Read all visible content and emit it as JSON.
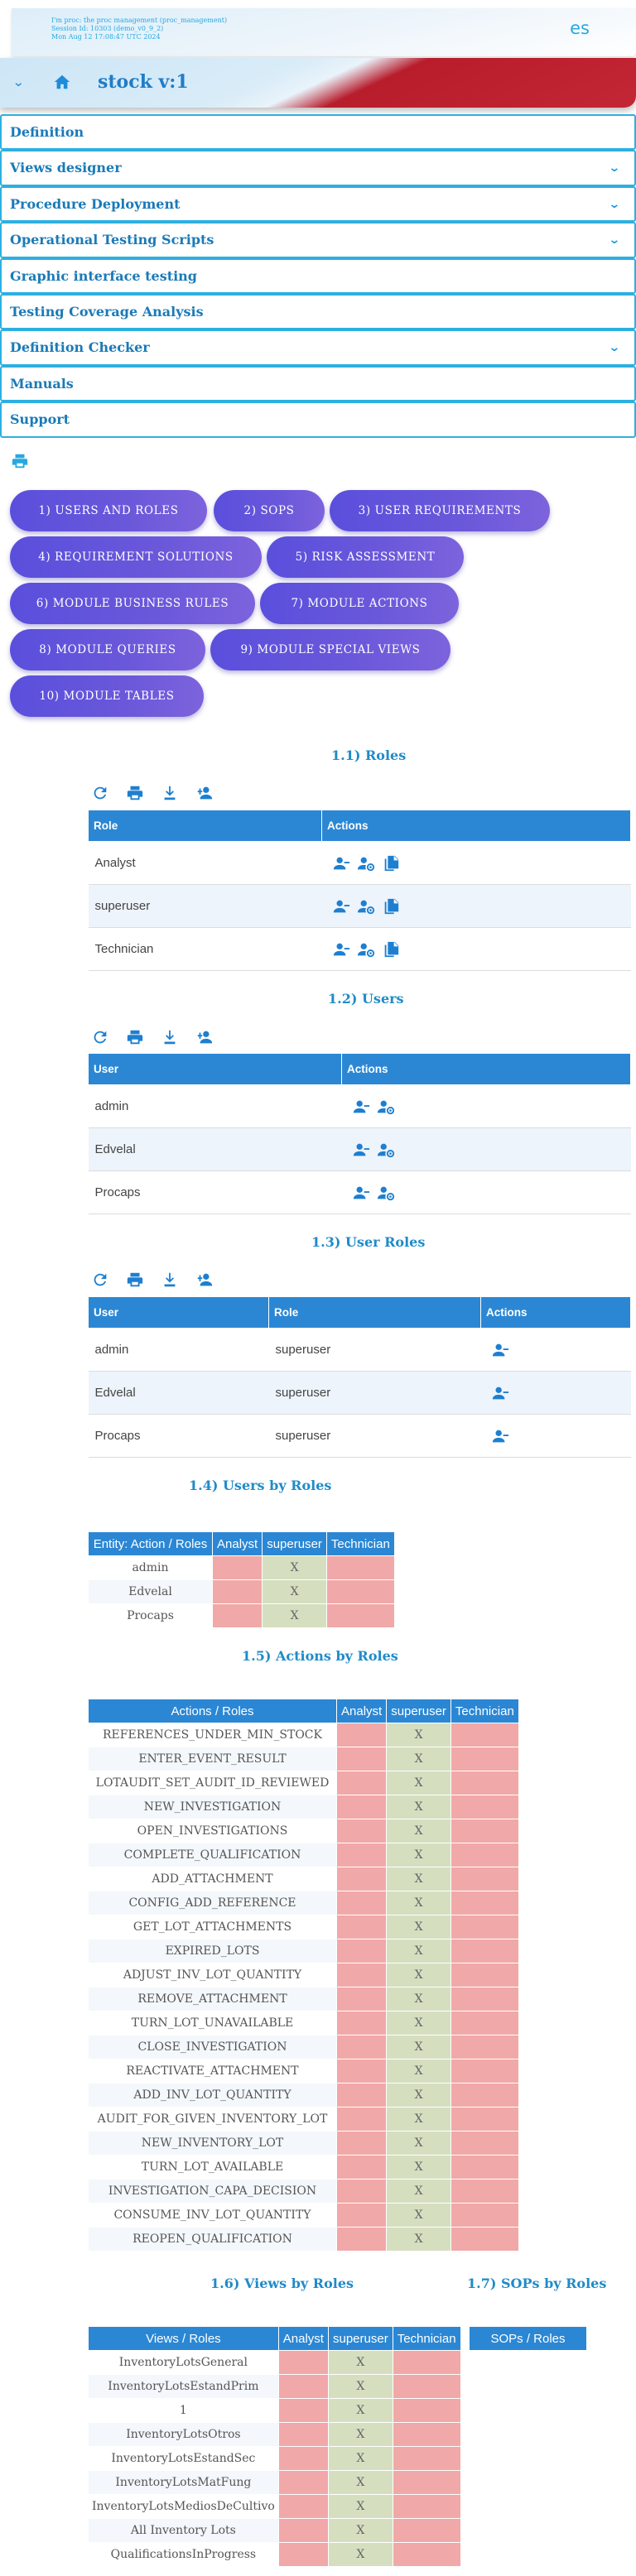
{
  "header": {
    "info_lines": [
      "I'm proc: the proc management (proc_management)",
      "Session Id: 10303 (demo_v0_9_2)",
      "Mon Aug 12 17:08:47 UTC 2024"
    ],
    "lang": "es",
    "app_title": "stock v:1"
  },
  "menu": [
    {
      "label": "Definition",
      "has_chevron": false
    },
    {
      "label": "Views designer",
      "has_chevron": true
    },
    {
      "label": "Procedure Deployment",
      "has_chevron": true
    },
    {
      "label": "Operational Testing Scripts",
      "has_chevron": true
    },
    {
      "label": "Graphic interface testing",
      "has_chevron": false
    },
    {
      "label": "Testing Coverage Analysis",
      "has_chevron": false
    },
    {
      "label": "Definition Checker",
      "has_chevron": true
    },
    {
      "label": "Manuals",
      "has_chevron": false
    },
    {
      "label": "Support",
      "has_chevron": false
    }
  ],
  "sections": [
    "1) USERS AND ROLES",
    "2) SOPS",
    "3) USER REQUIREMENTS",
    "4) REQUIREMENT SOLUTIONS",
    "5) RISK ASSESSMENT",
    "6) MODULE BUSINESS RULES",
    "7) MODULE ACTIONS",
    "8) MODULE QUERIES",
    "9) MODULE SPECIAL VIEWS",
    "10) MODULE TABLES"
  ],
  "titles": {
    "roles": "1.1) Roles",
    "users": "1.2) Users",
    "user_roles": "1.3) User Roles",
    "users_by_roles": "1.4) Users by Roles",
    "actions_by_roles": "1.5) Actions by Roles",
    "views_by_roles": "1.6) Views by Roles",
    "sops_by_roles": "1.7) SOPs by Roles"
  },
  "roles_table": {
    "headers": [
      "Role",
      "Actions"
    ],
    "rows": [
      "Analyst",
      "superuser",
      "Technician"
    ]
  },
  "users_table": {
    "headers": [
      "User",
      "Actions"
    ],
    "rows": [
      "admin",
      "Edvelal",
      "Procaps"
    ]
  },
  "user_roles_table": {
    "headers": [
      "User",
      "Role",
      "Actions"
    ],
    "rows": [
      [
        "admin",
        "superuser"
      ],
      [
        "Edvelal",
        "superuser"
      ],
      [
        "Procaps",
        "superuser"
      ]
    ]
  },
  "users_by_roles": {
    "headers": [
      "Entity: Action / Roles",
      "Analyst",
      "superuser",
      "Technician"
    ],
    "mark": "X",
    "rows": [
      "admin",
      "Edvelal",
      "Procaps"
    ]
  },
  "actions_by_roles": {
    "headers": [
      "Actions / Roles",
      "Analyst",
      "superuser",
      "Technician"
    ],
    "mark": "X",
    "rows": [
      "REFERENCES_UNDER_MIN_STOCK",
      "ENTER_EVENT_RESULT",
      "LOTAUDIT_SET_AUDIT_ID_REVIEWED",
      "NEW_INVESTIGATION",
      "OPEN_INVESTIGATIONS",
      "COMPLETE_QUALIFICATION",
      "ADD_ATTACHMENT",
      "CONFIG_ADD_REFERENCE",
      "GET_LOT_ATTACHMENTS",
      "EXPIRED_LOTS",
      "ADJUST_INV_LOT_QUANTITY",
      "REMOVE_ATTACHMENT",
      "TURN_LOT_UNAVAILABLE",
      "CLOSE_INVESTIGATION",
      "REACTIVATE_ATTACHMENT",
      "ADD_INV_LOT_QUANTITY",
      "AUDIT_FOR_GIVEN_INVENTORY_LOT",
      "NEW_INVENTORY_LOT",
      "TURN_LOT_AVAILABLE",
      "INVESTIGATION_CAPA_DECISION",
      "CONSUME_INV_LOT_QUANTITY",
      "REOPEN_QUALIFICATION"
    ]
  },
  "views_by_roles": {
    "headers": [
      "Views / Roles",
      "Analyst",
      "superuser",
      "Technician"
    ],
    "mark": "X",
    "rows": [
      "InventoryLotsGeneral",
      "InventoryLotsEstandPrim",
      "1",
      "InventoryLotsOtros",
      "InventoryLotsEstandSec",
      "InventoryLotsMatFung",
      "InventoryLotsMediosDeCultivo",
      "All Inventory Lots",
      "QualificationsInProgress"
    ]
  },
  "sops_by_roles": {
    "headers": [
      "SOPs / Roles"
    ]
  },
  "colors": {
    "accent": "#2b87d4",
    "button": "#5a4fdc",
    "deny": "#f1a8a8",
    "allow": "#d5dfc0",
    "title": "#1f8bc9"
  }
}
